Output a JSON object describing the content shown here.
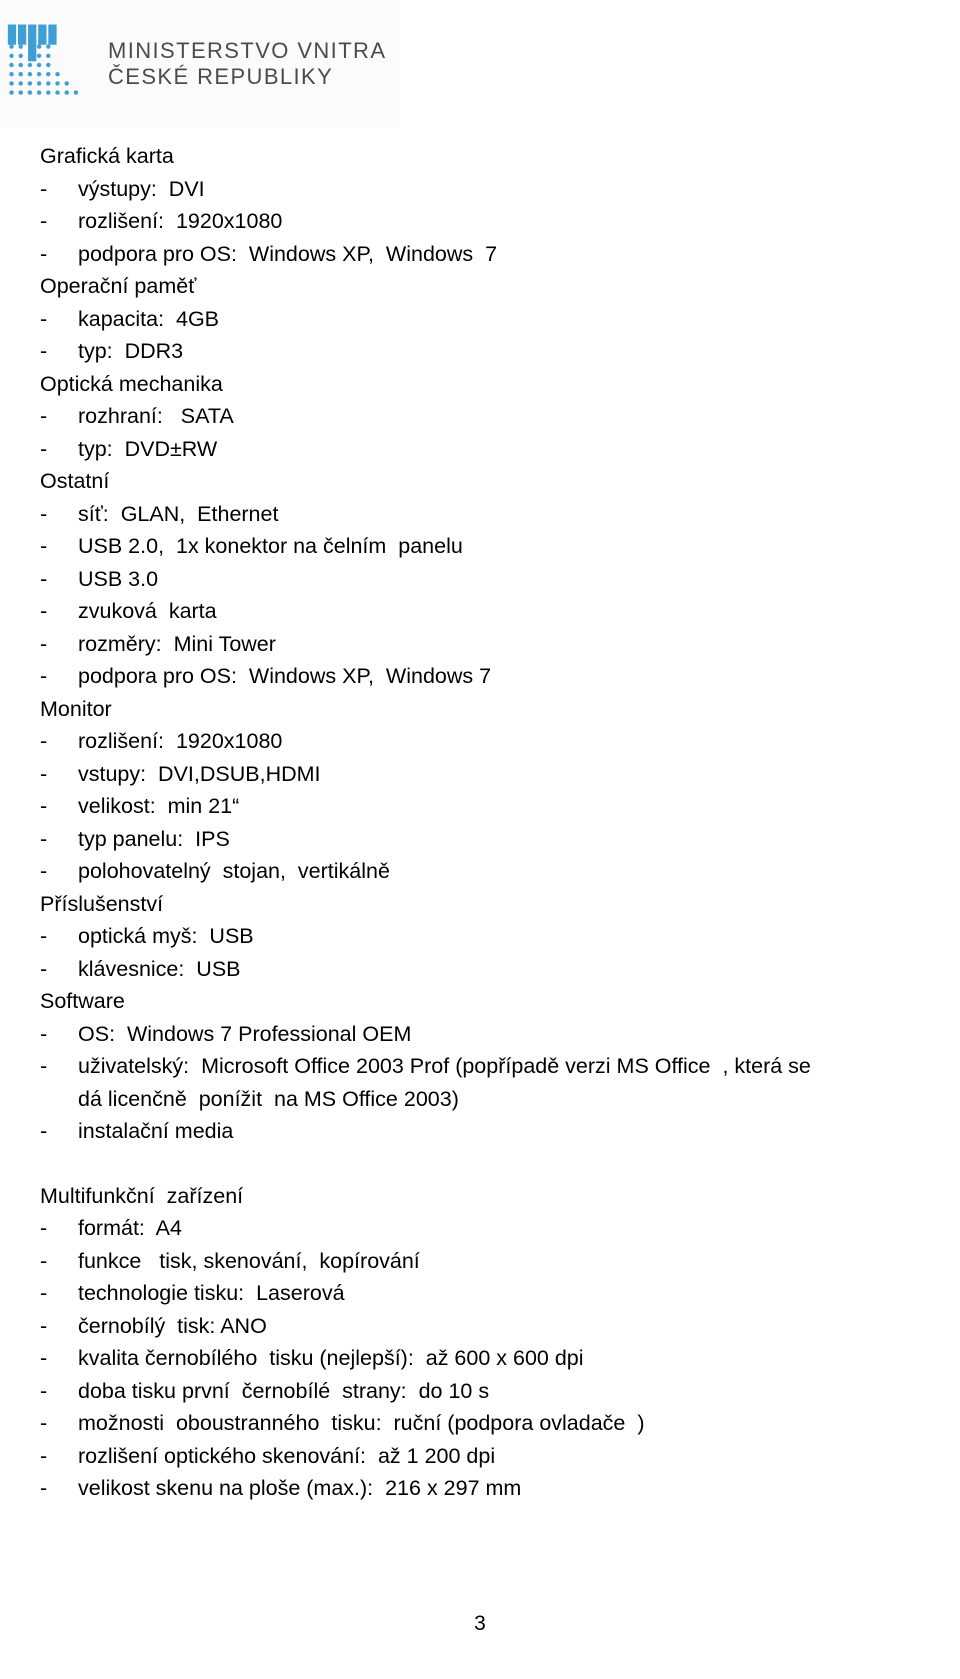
{
  "logo": {
    "line1": "MINISTERSTVO VNITRA",
    "line2": "ČESKÉ REPUBLIKY",
    "mark_color": "#3f9fd4"
  },
  "document": {
    "blocks": [
      {
        "type": "head",
        "text": "Grafická karta"
      },
      {
        "type": "bullet",
        "text": "výstupy:  DVI"
      },
      {
        "type": "bullet",
        "text": "rozlišení:  1920x1080"
      },
      {
        "type": "bullet",
        "text": "podpora pro OS:  Windows XP,  Windows  7"
      },
      {
        "type": "head",
        "text": "Operační paměť"
      },
      {
        "type": "bullet",
        "text": "kapacita:  4GB"
      },
      {
        "type": "bullet",
        "text": "typ:  DDR3"
      },
      {
        "type": "head",
        "text": "Optická mechanika"
      },
      {
        "type": "bullet",
        "text": "rozhraní:   SATA"
      },
      {
        "type": "bullet",
        "text": "typ:  DVD±RW"
      },
      {
        "type": "head",
        "text": "Ostatní"
      },
      {
        "type": "bullet",
        "text": "síť:  GLAN,  Ethernet"
      },
      {
        "type": "bullet",
        "text": "USB 2.0,  1x konektor na čelním  panelu"
      },
      {
        "type": "bullet",
        "text": "USB 3.0"
      },
      {
        "type": "bullet",
        "text": "zvuková  karta"
      },
      {
        "type": "bullet",
        "text": "rozměry:  Mini Tower"
      },
      {
        "type": "bullet",
        "text": "podpora pro OS:  Windows XP,  Windows 7"
      },
      {
        "type": "head",
        "text": "Monitor"
      },
      {
        "type": "bullet",
        "text": "rozlišení:  1920x1080"
      },
      {
        "type": "bullet",
        "text": "vstupy:  DVI,DSUB,HDMI"
      },
      {
        "type": "bullet",
        "text": "velikost:  min 21“"
      },
      {
        "type": "bullet",
        "text": "typ panelu:  IPS"
      },
      {
        "type": "bullet",
        "text": "polohovatelný  stojan,  vertikálně"
      },
      {
        "type": "head",
        "text": "Příslušenství"
      },
      {
        "type": "bullet",
        "text": "optická myš:  USB"
      },
      {
        "type": "bullet",
        "text": "klávesnice:  USB"
      },
      {
        "type": "head",
        "text": "Software"
      },
      {
        "type": "bullet",
        "text": "OS:  Windows 7 Professional OEM"
      },
      {
        "type": "bullet",
        "text": "uživatelský:  Microsoft Office 2003 Prof (popřípadě verzi MS Office  , která se"
      },
      {
        "type": "cont",
        "text": "dá licenčně  ponížit  na MS Office 2003)"
      },
      {
        "type": "bullet",
        "text": "instalační media"
      },
      {
        "type": "spacer",
        "text": ""
      },
      {
        "type": "head",
        "text": "Multifunkční  zařízení"
      },
      {
        "type": "bullet",
        "text": "formát:  A4"
      },
      {
        "type": "bullet",
        "text": "funkce   tisk, skenování,  kopírování"
      },
      {
        "type": "bullet",
        "text": "technologie tisku:  Laserová"
      },
      {
        "type": "bullet",
        "text": "černobílý  tisk: ANO"
      },
      {
        "type": "bullet",
        "text": "kvalita černobílého  tisku (nejlepší):  až 600 x 600 dpi"
      },
      {
        "type": "bullet",
        "text": "doba tisku první  černobílé  strany:  do 10 s"
      },
      {
        "type": "bullet",
        "text": "možnosti  oboustranného  tisku:  ruční (podpora ovladače  )"
      },
      {
        "type": "bullet",
        "text": "rozlišení optického skenování:  až 1 200 dpi"
      },
      {
        "type": "bullet",
        "text": "velikost skenu na ploše (max.):  216 x 297 mm"
      }
    ],
    "bullet_marker": "-"
  },
  "footer": {
    "page_number": "3"
  }
}
